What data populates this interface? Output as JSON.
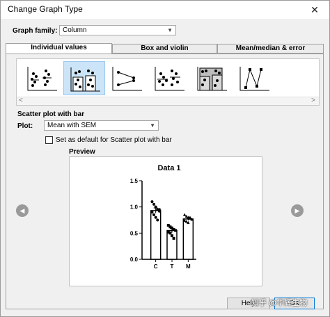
{
  "window": {
    "title": "Change Graph Type",
    "close_glyph": "✕"
  },
  "graph_family": {
    "label": "Graph family:",
    "value": "Column"
  },
  "tabs": [
    {
      "label": "Individual values",
      "active": true
    },
    {
      "label": "Box and violin",
      "active": false
    },
    {
      "label": "Mean/median & error",
      "active": false
    }
  ],
  "gallery": {
    "thumbnails": [
      {
        "name": "scatter-icon"
      },
      {
        "name": "scatter-with-bar-icon",
        "selected": true
      },
      {
        "name": "before-after-icon"
      },
      {
        "name": "scatter-lines-icon"
      },
      {
        "name": "scatter-gray-bar-icon"
      },
      {
        "name": "before-after-lines-icon"
      }
    ],
    "scroll_left": "<",
    "scroll_right": ">"
  },
  "section_title": "Scatter plot with bar",
  "plot": {
    "label": "Plot:",
    "value": "Mean with SEM"
  },
  "default_checkbox": {
    "label": "Set as default for Scatter plot with bar",
    "checked": false
  },
  "preview": {
    "label": "Preview"
  },
  "chart_data": {
    "type": "bar",
    "title": "Data 1",
    "categories": [
      "C",
      "T",
      "M"
    ],
    "values": [
      0.93,
      0.55,
      0.77
    ],
    "errors": [
      0.05,
      0.04,
      0.03
    ],
    "points": [
      [
        1.1,
        1.05,
        1.0,
        0.95,
        0.92,
        0.9,
        0.85,
        0.8,
        0.75,
        0.95
      ],
      [
        0.65,
        0.62,
        0.6,
        0.57,
        0.55,
        0.52,
        0.5,
        0.45,
        0.4
      ],
      [
        0.85,
        0.82,
        0.8,
        0.78,
        0.76,
        0.74,
        0.72,
        0.7,
        0.8
      ]
    ],
    "markers": [
      "circle",
      "square",
      "triangle"
    ],
    "ylim": [
      0,
      1.5
    ],
    "yticks": [
      "0.0",
      "0.5",
      "1.0",
      "1.5"
    ],
    "xlabel": "",
    "ylabel": "",
    "grid": false
  },
  "nav": {
    "prev_glyph": "◀",
    "next_glyph": "▶"
  },
  "buttons": {
    "help": "Help",
    "ok": "OK"
  },
  "watermark": "知乎 @华辉生物"
}
